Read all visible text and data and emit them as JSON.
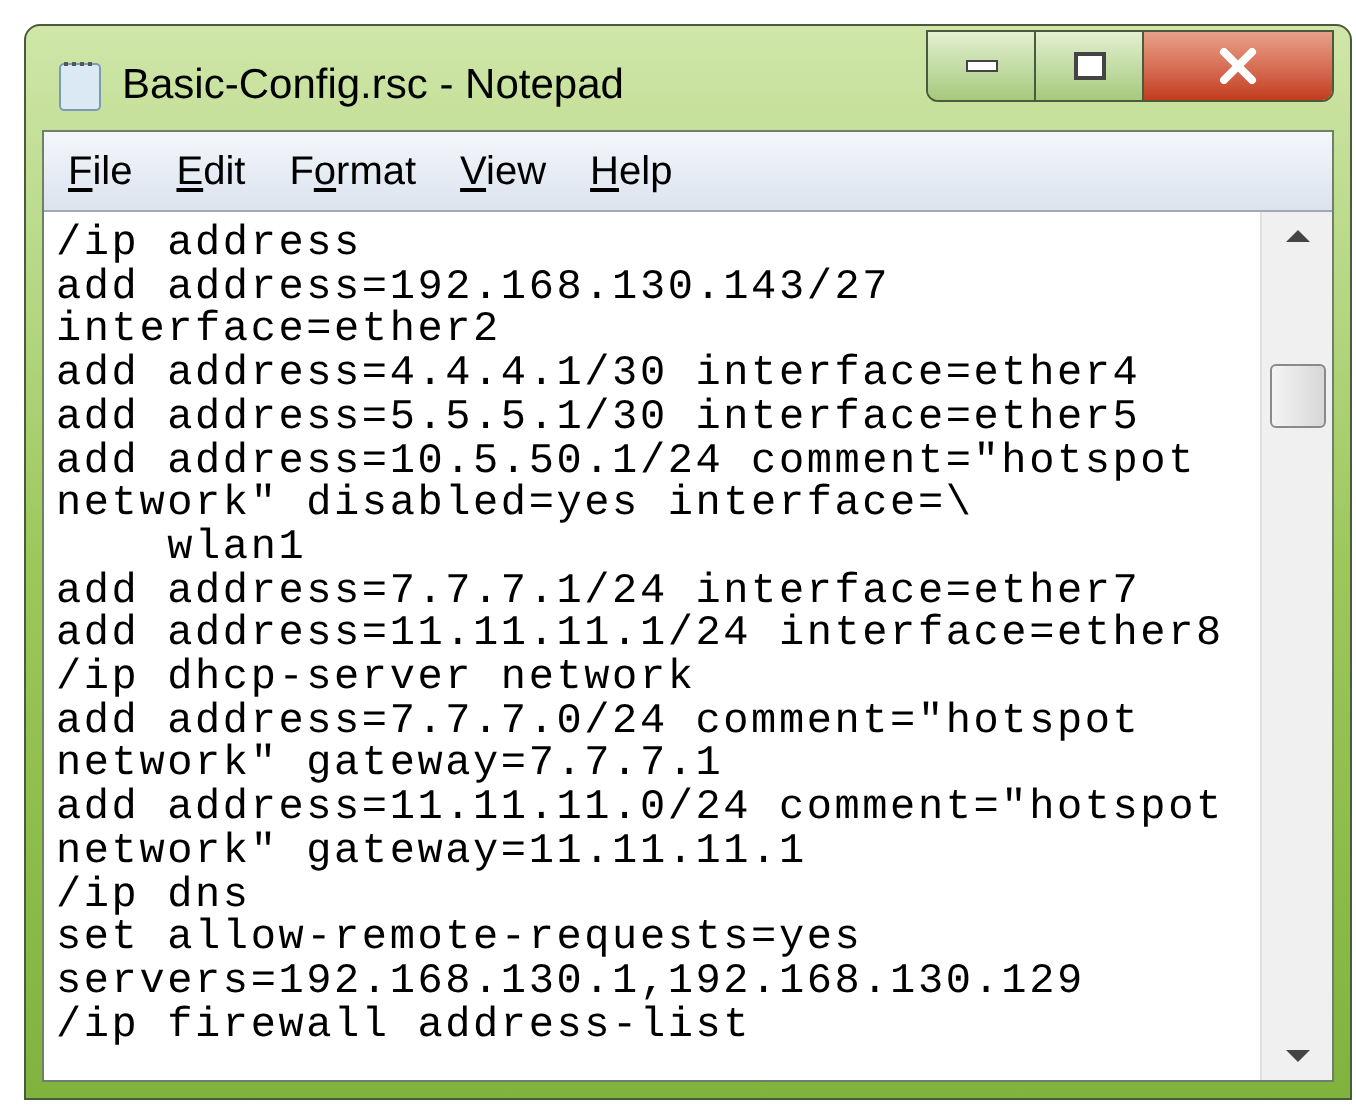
{
  "window": {
    "title": "Basic-Config.rsc - Notepad"
  },
  "menu": [
    {
      "parts": [
        {
          "text": "F",
          "underlined": true
        },
        {
          "text": "ile",
          "underlined": false
        }
      ]
    },
    {
      "parts": [
        {
          "text": "E",
          "underlined": true
        },
        {
          "text": "dit",
          "underlined": false
        }
      ]
    },
    {
      "parts": [
        {
          "text": "F",
          "underlined": false
        },
        {
          "text": "o",
          "underlined": true
        },
        {
          "text": "rmat",
          "underlined": false
        }
      ]
    },
    {
      "parts": [
        {
          "text": "V",
          "underlined": true
        },
        {
          "text": "iew",
          "underlined": false
        }
      ]
    },
    {
      "parts": [
        {
          "text": "H",
          "underlined": true
        },
        {
          "text": "elp",
          "underlined": false
        }
      ]
    }
  ],
  "editor": {
    "lines": [
      "/ip address",
      "add address=192.168.130.143/27",
      "interface=ether2",
      "add address=4.4.4.1/30 interface=ether4",
      "add address=5.5.5.1/30 interface=ether5",
      "add address=10.5.50.1/24 comment=\"hotspot",
      "network\" disabled=yes interface=\\",
      "    wlan1",
      "add address=7.7.7.1/24 interface=ether7",
      "add address=11.11.11.1/24 interface=ether8",
      "/ip dhcp-server network",
      "add address=7.7.7.0/24 comment=\"hotspot",
      "network\" gateway=7.7.7.1",
      "add address=11.11.11.0/24 comment=\"hotspot",
      "network\" gateway=11.11.11.1",
      "/ip dns",
      "set allow-remote-requests=yes",
      "servers=192.168.130.1,192.168.130.129",
      "/ip firewall address-list"
    ]
  }
}
